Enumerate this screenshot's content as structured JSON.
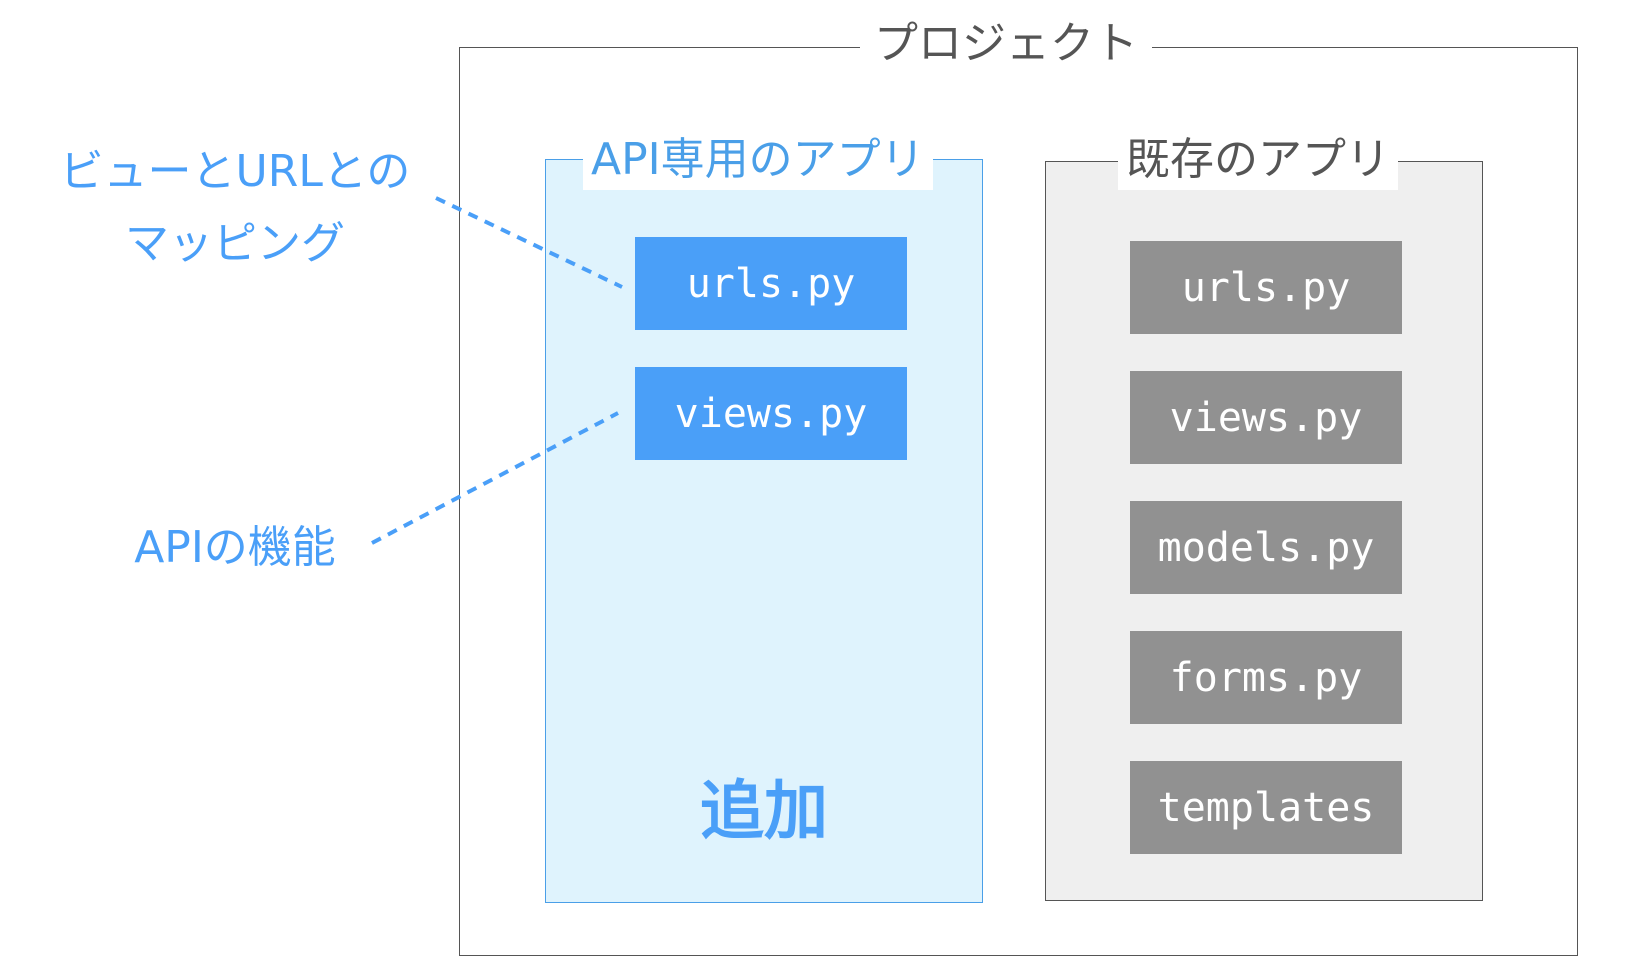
{
  "project": {
    "title": "プロジェクト"
  },
  "api_app": {
    "title": "API専用のアプリ",
    "files": [
      "urls.py",
      "views.py"
    ],
    "added_label": "追加"
  },
  "existing_app": {
    "title": "既存のアプリ",
    "files": [
      "urls.py",
      "views.py",
      "models.py",
      "forms.py",
      "templates"
    ]
  },
  "annotations": {
    "url_mapping": {
      "line1": "ビューとURLとの",
      "line2": "マッピング",
      "points_to": "urls.py"
    },
    "api_function": {
      "text": "APIの機能",
      "points_to": "views.py"
    }
  },
  "colors": {
    "accent_blue": "#4a9ff8",
    "gray_box": "#919191",
    "light_blue_bg": "#dff3fd",
    "gray_bg": "#efefef",
    "frame": "#555555"
  }
}
